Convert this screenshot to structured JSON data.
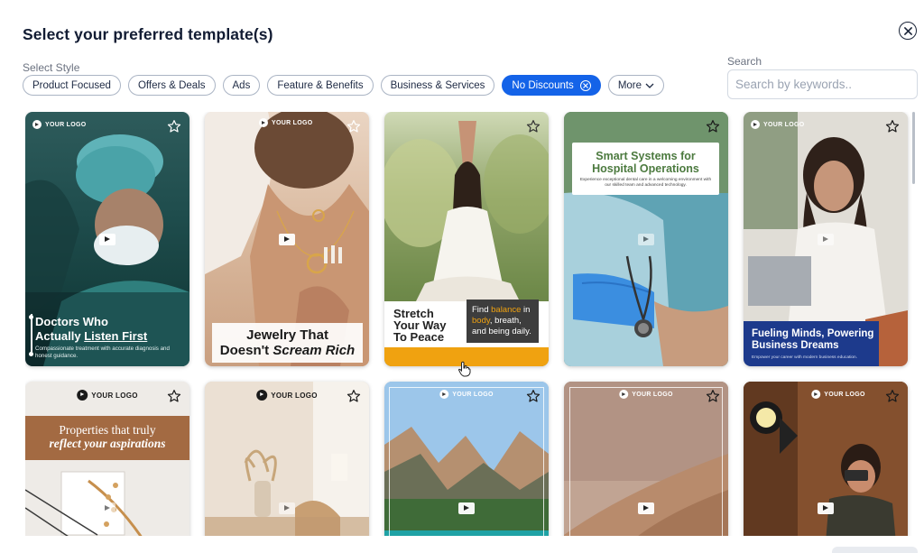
{
  "title": "Select your preferred template(s)",
  "style_label": "Select Style",
  "chips": [
    {
      "label": "Product Focused",
      "active": false
    },
    {
      "label": "Offers & Deals",
      "active": false
    },
    {
      "label": "Ads",
      "active": false
    },
    {
      "label": "Feature & Benefits",
      "active": false
    },
    {
      "label": "Business & Services",
      "active": false
    },
    {
      "label": "No Discounts",
      "active": true
    },
    {
      "label": "More",
      "active": false
    }
  ],
  "search": {
    "label": "Search",
    "placeholder": "Search by keywords.."
  },
  "logo_text": "YOUR LOGO",
  "cards": [
    {
      "heading1": "Doctors Who",
      "heading2a": "Actually ",
      "heading2b": "Listen First",
      "sub": "Compassionate treatment with accurate diagnosis and honest guidance."
    },
    {
      "heading1": "Jewelry That",
      "heading2a": "Doesn't ",
      "heading2b": "Scream Rich"
    },
    {
      "left1": "Stretch",
      "left2": "Your Way",
      "left3": "To Peace",
      "r1a": "Find ",
      "r1b": "balance",
      "r1c": " in",
      "r2a": "body",
      "r2b": ", breath,",
      "r3": "and being daily."
    },
    {
      "heading1": "Smart Systems for",
      "heading2": "Hospital Operations",
      "sub": "Experience exceptional dental care in a welcoming environment with our skilled team and advanced technology."
    },
    {
      "heading1": "Fueling Minds, Powering",
      "heading2": "Business Dreams",
      "sub": "Empower your career with modern business education."
    },
    {
      "heading1": "Properties that truly",
      "heading2": "reflect your aspirations"
    }
  ],
  "colors": {
    "accent": "#1463e8",
    "title": "#121c33",
    "chip_border": "#aab4c4",
    "orange_bar": "#f0a210"
  },
  "icons": [
    "close-icon",
    "star-icon",
    "play-icon",
    "chevron-down-icon",
    "clear-icon",
    "hand-cursor-icon"
  ]
}
